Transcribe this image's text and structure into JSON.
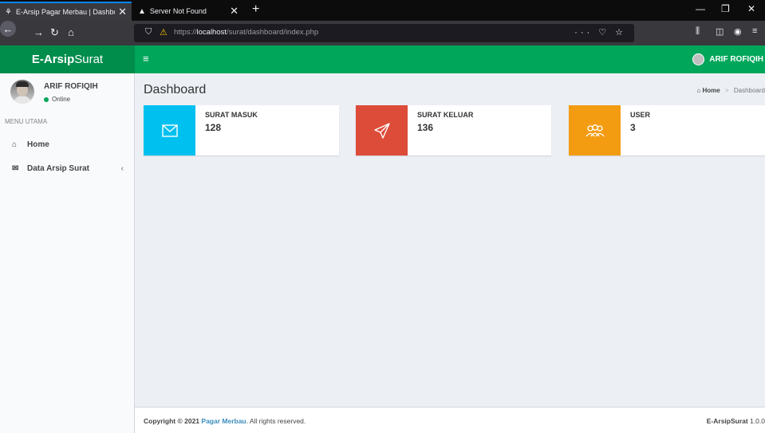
{
  "browser": {
    "tabs": [
      {
        "label": "E-Arsip Pagar Merbau | Dashbo",
        "icon": "page-icon",
        "active": true
      },
      {
        "label": "Server Not Found",
        "icon": "warning-icon",
        "active": false
      }
    ],
    "url_prefix": "https://",
    "url_host": "localhost",
    "url_path": "/surat/dashboard/index.php"
  },
  "header": {
    "logo_bold": "E-Arsip",
    "logo_rest": "Surat",
    "user_name": "ARIF ROFIQIH"
  },
  "sidebar": {
    "user_name": "ARIF ROFIQIH",
    "status": "Online",
    "menu_header": "MENU UTAMA",
    "items": [
      {
        "label": "Home",
        "icon": "home-icon"
      },
      {
        "label": "Data Arsip Surat",
        "icon": "envelope-icon"
      }
    ]
  },
  "main": {
    "title": "Dashboard",
    "breadcrumb": {
      "home": "Home",
      "current": "Dashboard"
    },
    "info_boxes": [
      {
        "label": "SURAT MASUK",
        "value": "128",
        "icon": "envelope-icon",
        "color": "#00c0ef"
      },
      {
        "label": "SURAT KELUAR",
        "value": "136",
        "icon": "paper-plane-icon",
        "color": "#dd4b39"
      },
      {
        "label": "USER",
        "value": "3",
        "icon": "users-icon",
        "color": "#f39c12"
      }
    ]
  },
  "footer": {
    "copyright": "Copyright © 2021 ",
    "brand": "Pagar Merbau",
    "rights": ". All rights reserved.",
    "app_name": "E-ArsipSurat",
    "version": "1.0.0"
  },
  "colors": {
    "header_green": "#00a65a",
    "logo_green": "#008d4c"
  }
}
